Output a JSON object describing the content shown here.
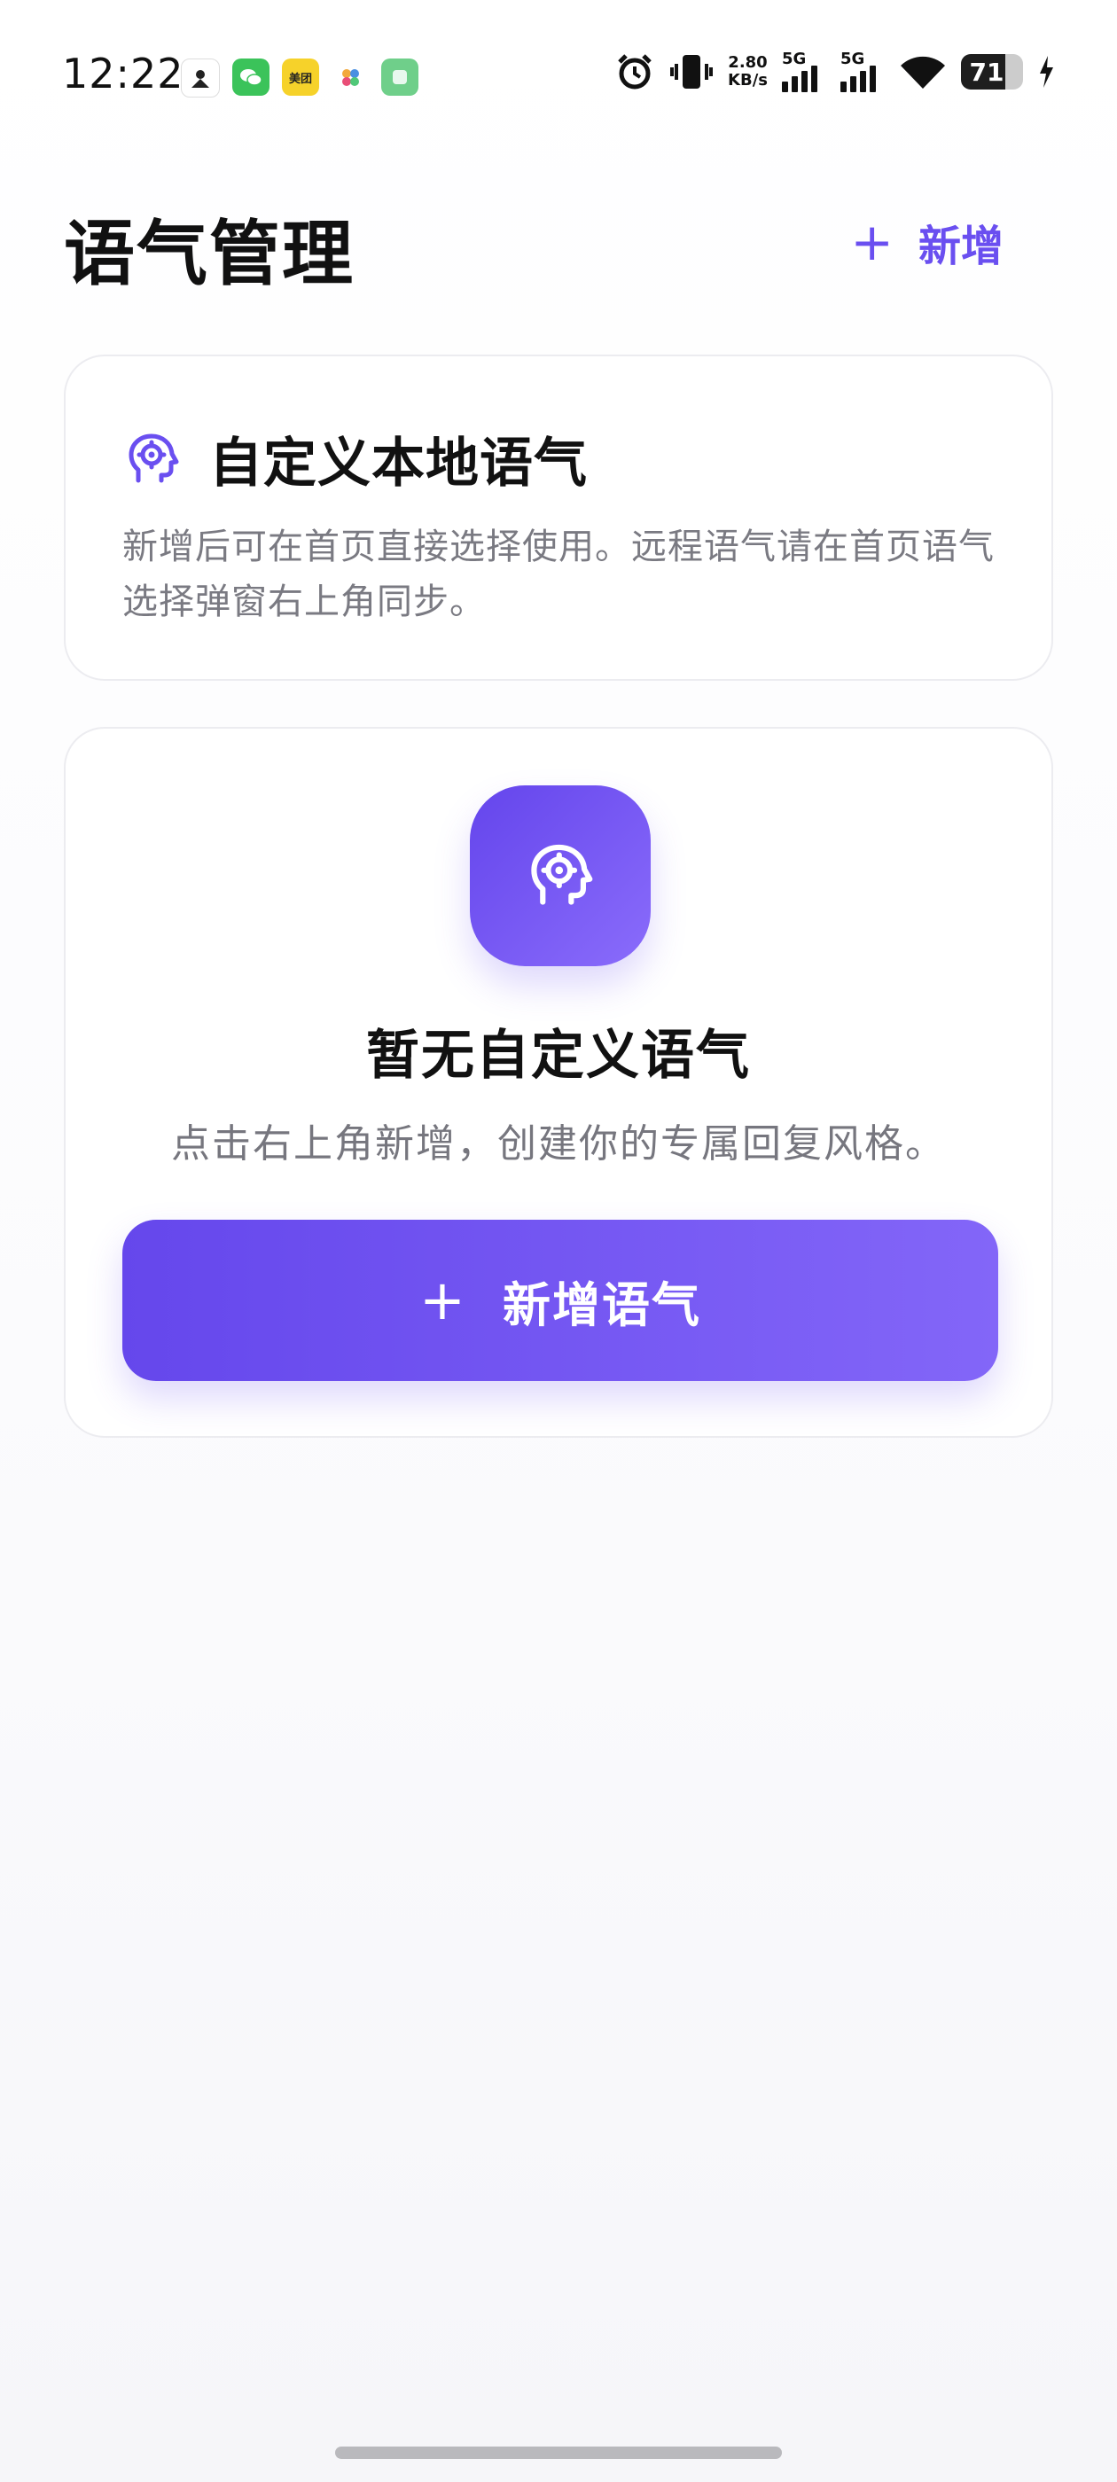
{
  "status_bar": {
    "time": "12:22",
    "net_speed_value": "2.80",
    "net_speed_unit": "KB/s",
    "signal_1_label": "5G",
    "signal_2_label": "5G",
    "battery": "71",
    "battery_level_percent": 71,
    "notification_icons": [
      "app-icon",
      "wechat-icon",
      "meituan-icon",
      "color-dots-app-icon",
      "green-app-icon"
    ],
    "meituan_label": "美团"
  },
  "header": {
    "title": "语气管理",
    "add_label": "新增",
    "add_icon": "plus-icon"
  },
  "info_card": {
    "icon": "head-gear-icon",
    "title": "自定义本地语气",
    "description": "新增后可在首页直接选择使用。远程语气请在首页语气选择弹窗右上角同步。"
  },
  "empty_state": {
    "icon": "head-gear-icon",
    "title": "暂无自定义语气",
    "description": "点击右上角新增，创建你的专属回复风格。",
    "button_label": "新增语气",
    "button_icon": "plus-icon"
  },
  "colors": {
    "accent": "#6a4ff0",
    "gradient_start": "#6445ec",
    "gradient_end": "#8a6cfb",
    "text_primary": "#111111",
    "text_secondary": "#7a7a82"
  }
}
